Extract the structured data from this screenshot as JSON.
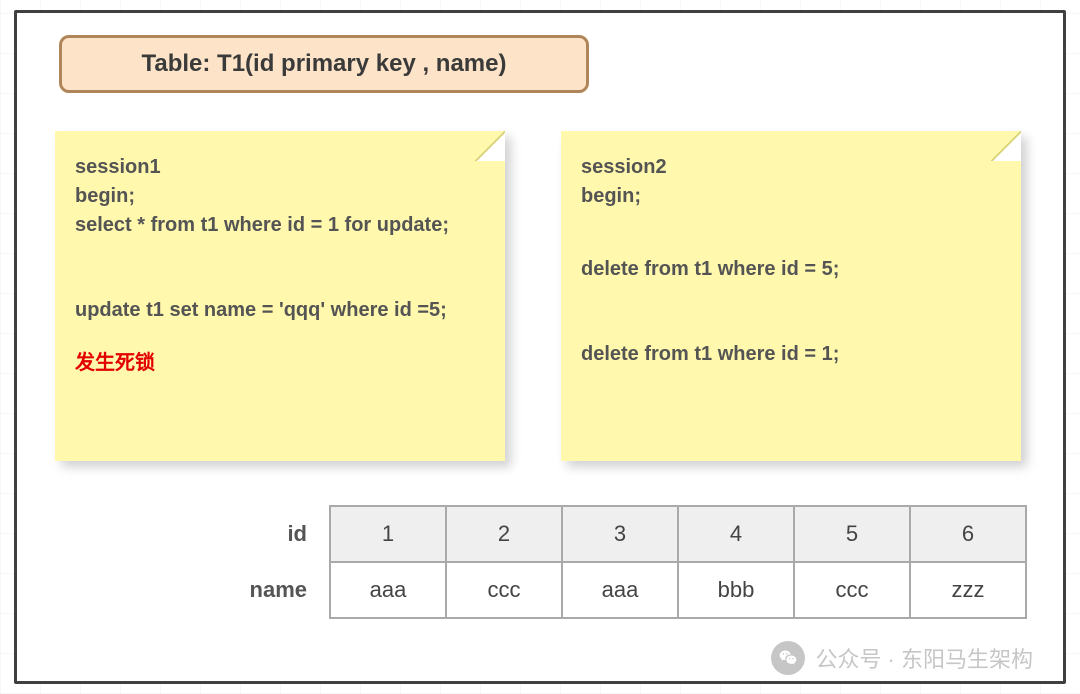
{
  "title": "Table: T1(id primary key , name)",
  "session1": {
    "header": "session1",
    "begin": "begin;",
    "line1": "select * from t1 where id = 1 for update;",
    "line2": "update t1 set name = 'qqq' where id =5;",
    "deadlock": "发生死锁"
  },
  "session2": {
    "header": "session2",
    "begin": "begin;",
    "line1": "delete from t1 where id = 5;",
    "line2": "delete from t1 where id = 1;"
  },
  "table": {
    "id_label": "id",
    "name_label": "name",
    "ids": [
      "1",
      "2",
      "3",
      "4",
      "5",
      "6"
    ],
    "names": [
      "aaa",
      "ccc",
      "aaa",
      "bbb",
      "ccc",
      "zzz"
    ]
  },
  "watermark": "公众号 · 东阳马生架构"
}
